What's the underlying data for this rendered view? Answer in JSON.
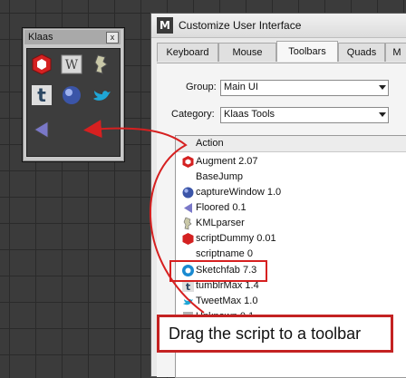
{
  "toolbar": {
    "title": "Klaas",
    "close_label": "x"
  },
  "dialog": {
    "logo": "M",
    "title": "Customize User Interface",
    "tabs": [
      "Keyboard",
      "Mouse",
      "Toolbars",
      "Quads",
      "M"
    ],
    "group_label": "Group:",
    "group_value": "Main UI",
    "category_label": "Category:",
    "category_value": "Klaas Tools",
    "list_header": "Action",
    "actions": [
      "Augment 2.07",
      "BaseJump",
      "captureWindow 1.0",
      "Floored 0.1",
      "KMLparser",
      "scriptDummy 0.01",
      "scriptname 0",
      "Sketchfab 7.3",
      "tumblrMax 1.4",
      "TweetMax 1.0",
      "Unknown 0.1"
    ]
  },
  "annotation": {
    "callout_text": "Drag the script to a toolbar",
    "highlight_color": "#d62020"
  }
}
